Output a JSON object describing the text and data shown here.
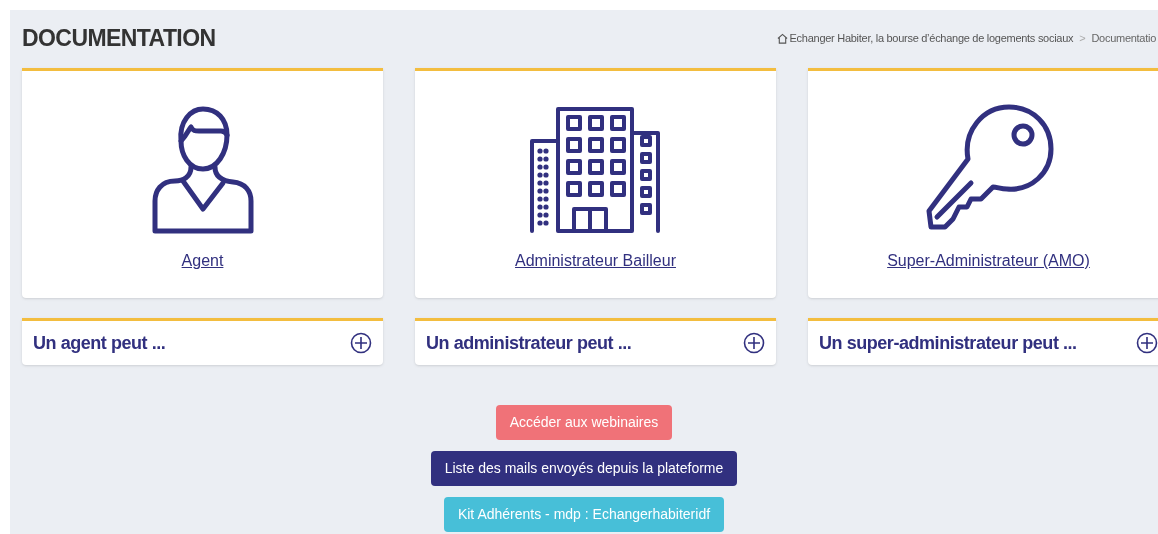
{
  "page_title": "DOCUMENTATION",
  "breadcrumb": [
    "Echanger Habiter, la bourse d’échange de logements sociaux",
    "Documentatio"
  ],
  "breadcrumb_separator": ">",
  "roles": [
    {
      "kind": "person",
      "label": "Agent"
    },
    {
      "kind": "building",
      "label": "Administrateur Bailleur"
    },
    {
      "kind": "key",
      "label": "Super-Administrateur (AMO)"
    }
  ],
  "panels": [
    {
      "title": "Un agent peut ...",
      "expanded": false
    },
    {
      "title": "Un administrateur peut ...",
      "expanded": false
    },
    {
      "title": "Un super-administrateur peut ...",
      "expanded": false
    }
  ],
  "buttons": [
    {
      "label": "Accéder aux webinaires",
      "kind": "danger"
    },
    {
      "label": "Liste des mails envoyés depuis la plateforme",
      "kind": "primary"
    },
    {
      "label": "Kit Adhérents - mdp : Echangerhabiteridf",
      "kind": "info"
    }
  ]
}
